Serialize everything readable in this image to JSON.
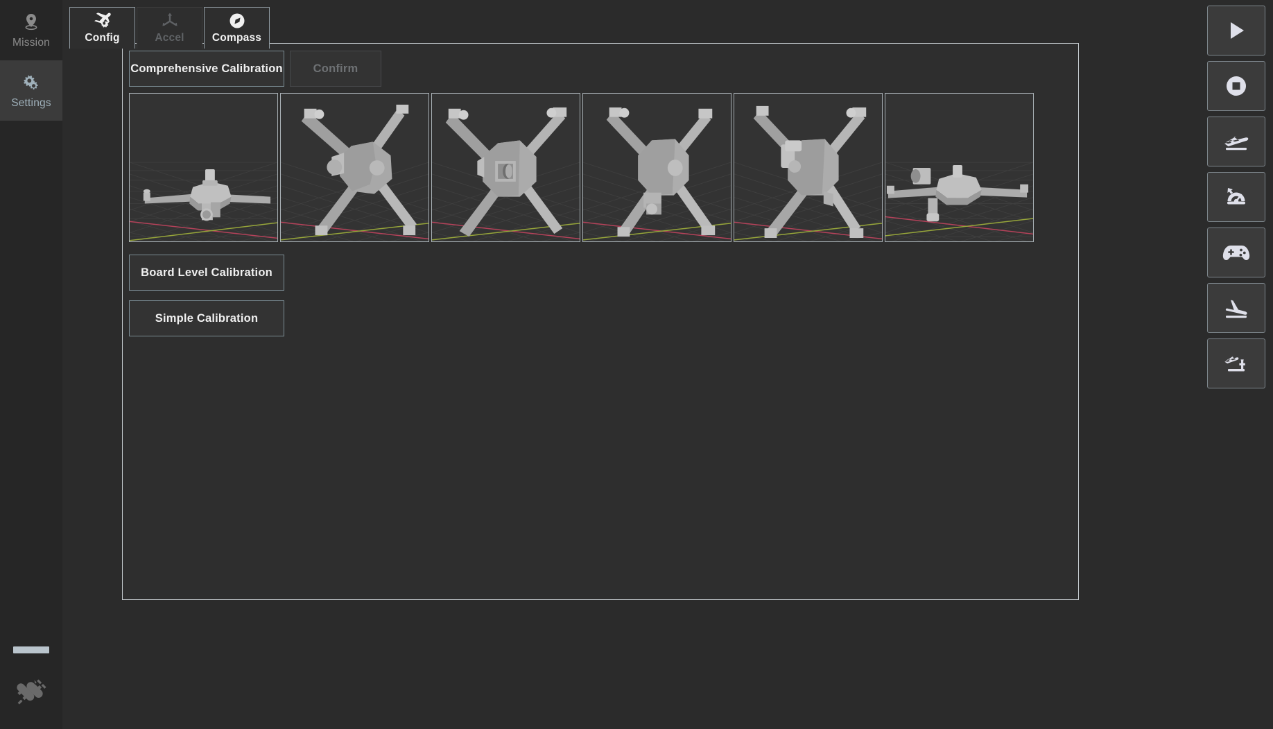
{
  "app": {
    "background": "#2b2b2b",
    "panel_background": "#2e2e2e",
    "accent_border": "#c3c9cd"
  },
  "sidebar": {
    "items": [
      {
        "id": "mission",
        "label": "Mission",
        "icon": "map-pin-icon",
        "active": false
      },
      {
        "id": "settings",
        "label": "Settings",
        "icon": "gears-icon",
        "active": true
      }
    ],
    "status": {
      "connection_icon": "disconnected-plug-icon",
      "bar_color": "#b9c4cc"
    }
  },
  "tabs": [
    {
      "id": "config",
      "label": "Config",
      "icon": "plane-gear-icon",
      "state": "active"
    },
    {
      "id": "accel",
      "label": "Accel",
      "icon": "three-axis-icon",
      "state": "disabled"
    },
    {
      "id": "compass",
      "label": "Compass",
      "icon": "compass-icon",
      "state": "selected"
    }
  ],
  "panel": {
    "buttons": {
      "comprehensive": "Comprehensive Calibration",
      "confirm": "Confirm",
      "confirm_enabled": false,
      "board_level": "Board Level Calibration",
      "simple": "Simple Calibration"
    },
    "orientations": [
      {
        "id": "level",
        "name": "level-orientation",
        "pose": "Level"
      },
      {
        "id": "nose-down",
        "name": "nose-down-orientation",
        "pose": "Nose Down"
      },
      {
        "id": "nose-front",
        "name": "nose-front-orientation",
        "pose": "Nose Front"
      },
      {
        "id": "left-side",
        "name": "left-side-orientation",
        "pose": "Left Side"
      },
      {
        "id": "right-side",
        "name": "right-side-orientation",
        "pose": "Right Side"
      },
      {
        "id": "upside-down",
        "name": "upside-down-orientation",
        "pose": "Upside Down"
      }
    ],
    "scene": {
      "grid_color": "#3d3d3d",
      "axis_x_color": "#b5425a",
      "axis_y_color": "#97a63a",
      "body_color": "#b0b0b0"
    }
  },
  "toolbar": [
    {
      "id": "start",
      "label": "Start",
      "icon": "play-icon"
    },
    {
      "id": "stop",
      "label": "Stop",
      "icon": "stop-circle-icon"
    },
    {
      "id": "takeoff",
      "label": "Takeoff",
      "icon": "plane-takeoff-icon"
    },
    {
      "id": "speed",
      "label": "Speed",
      "icon": "gauge-icon"
    },
    {
      "id": "joystick",
      "label": "Joystick",
      "icon": "gamepad-icon"
    },
    {
      "id": "land",
      "label": "Land",
      "icon": "plane-landing-icon"
    },
    {
      "id": "rtl",
      "label": "Return Home",
      "icon": "control-tower-icon"
    }
  ]
}
